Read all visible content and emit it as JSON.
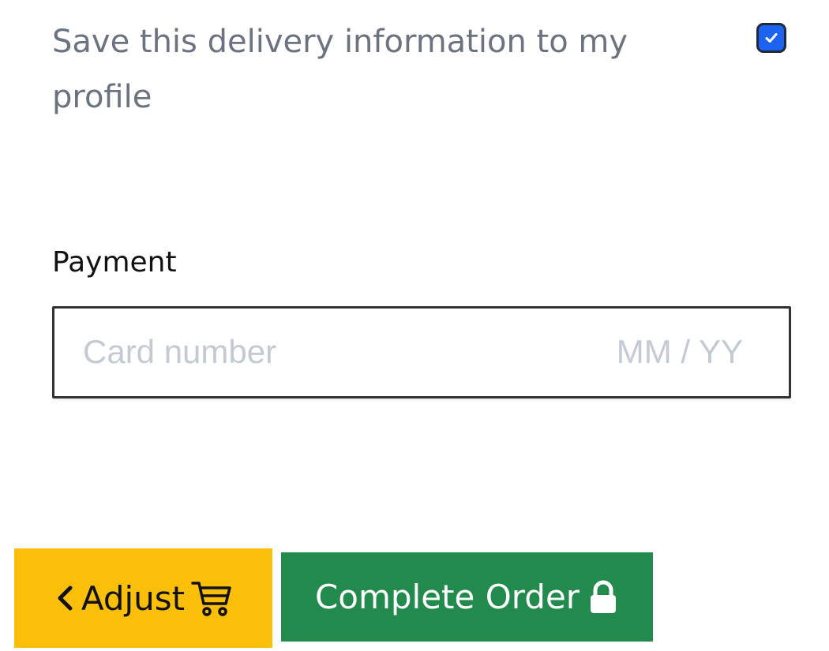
{
  "save_delivery": {
    "label": "Save this delivery information to my profile",
    "checked": true,
    "checkbox_color": "#1d62f0"
  },
  "payment": {
    "heading": "Payment",
    "card_number_placeholder": "Card number",
    "card_number_value": "",
    "expiry_placeholder": "MM / YY",
    "expiry_value": ""
  },
  "actions": {
    "adjust_label": "Adjust",
    "adjust_left_icon": "chevron-left-icon",
    "adjust_right_icon": "cart-icon",
    "adjust_color": "#fbbf09",
    "complete_label": "Complete Order",
    "complete_icon": "lock-icon",
    "complete_color": "#228a4c"
  }
}
